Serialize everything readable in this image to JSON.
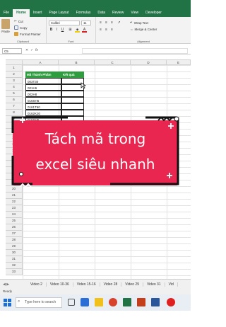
{
  "ribbon_tabs": [
    "File",
    "Home",
    "Insert",
    "Page Layout",
    "Formulas",
    "Data",
    "Review",
    "View",
    "Developer"
  ],
  "active_tab": "Home",
  "clipboard": {
    "paste": "Paste",
    "cut": "Cut",
    "copy": "Copy",
    "format_painter": "Format Painter",
    "group_label": "Clipboard"
  },
  "font": {
    "family": "Calibri",
    "size": "11",
    "bold": "B",
    "italic": "I",
    "underline": "U",
    "grow": "A",
    "shrink": "A",
    "group_label": "Font"
  },
  "alignment": {
    "wrap_text": "Wrap Text",
    "merge_center": "Merge & Center",
    "group_label": "Alignment"
  },
  "formula_bar": {
    "name_box": "C5",
    "fx": "fx"
  },
  "columns": [
    "A",
    "B",
    "C",
    "D",
    "E"
  ],
  "rows": [
    "1",
    "2",
    "3",
    "4",
    "5",
    "6",
    "7",
    "8",
    "9",
    "10",
    "11",
    "12",
    "13",
    "14",
    "15",
    "16",
    "17",
    "18",
    "19",
    "20",
    "21",
    "22",
    "23",
    "24",
    "25",
    "26",
    "27",
    "28",
    "29",
    "30",
    "31",
    "32",
    "33"
  ],
  "table": {
    "header_code": "Mã Thành Phẩm",
    "header_result": "Kết quả",
    "codes": [
      "003T30",
      "001H6",
      "002H8",
      "016SH6",
      "0161T60",
      "0162K30",
      "016SH6"
    ]
  },
  "banner": {
    "line1": "Tách mã trong",
    "line2": "excel siêu nhanh"
  },
  "sheet_tabs": [
    "Video 2",
    "Video 10-36",
    "Video 15-16",
    "Video 28",
    "Video 29",
    "Video 31",
    "Vid"
  ],
  "status": "Ready",
  "taskbar": {
    "search_placeholder": "Type here to search"
  },
  "colors": {
    "excel_green": "#217346",
    "header_fill": "#2e9d3e",
    "banner": "#e8264f"
  }
}
